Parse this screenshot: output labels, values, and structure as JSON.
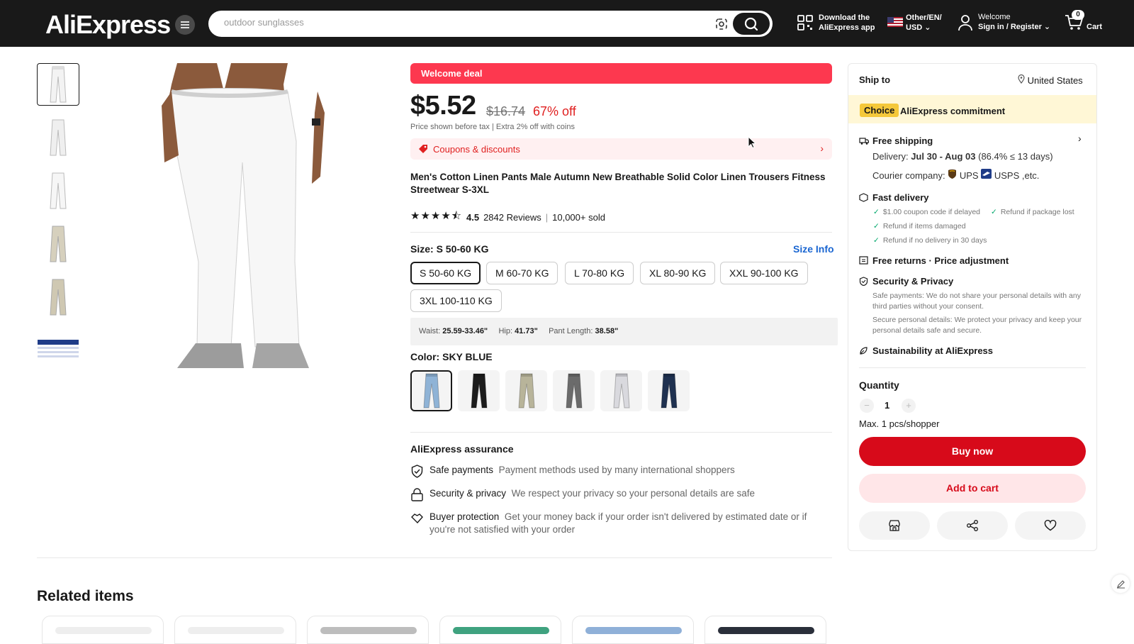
{
  "header": {
    "logo": "AliExpress",
    "search_placeholder": "outdoor sunglasses",
    "download_line1": "Download the",
    "download_line2": "AliExpress app",
    "locale_line1": "Other/EN/",
    "locale_line2": "USD",
    "welcome_line1": "Welcome",
    "welcome_line2": "Sign in / Register",
    "cart_count": "0",
    "cart_label": "Cart"
  },
  "product": {
    "welcome_deal": "Welcome deal",
    "price": "$5.52",
    "old_price": "$16.74",
    "discount": "67% off",
    "tax_note": "Price shown before tax",
    "coins_note": "Extra 2% off with coins",
    "coupons": "Coupons & discounts",
    "title": "Men's Cotton Linen Pants Male Autumn New Breathable Solid Color Linen Trousers Fitness Streetwear S-3XL",
    "rating": "4.5",
    "reviews": "2842 Reviews",
    "sold": "10,000+ sold",
    "size_label": "Size: S 50-60 KG",
    "size_info": "Size Info",
    "sizes": [
      "S 50-60 KG",
      "M 60-70 KG",
      "L 70-80 KG",
      "XL 80-90 KG",
      "XXL 90-100 KG",
      "3XL 100-110 KG"
    ],
    "measure": {
      "waist_k": "Waist:",
      "waist_v": "25.59-33.46\"",
      "hip_k": "Hip:",
      "hip_v": "41.73\"",
      "len_k": "Pant Length:",
      "len_v": "38.58\""
    },
    "color_label": "Color: SKY BLUE",
    "colors": [
      "#8fb3d6",
      "#1c1c1c",
      "#b8b49a",
      "#6b6b6b",
      "#d9d9de",
      "#1f3150"
    ]
  },
  "assurance": {
    "title": "AliExpress assurance",
    "items": [
      {
        "k": "Safe payments",
        "v": "Payment methods used by many international shoppers"
      },
      {
        "k": "Security & privacy",
        "v": "We respect your privacy so your personal details are safe"
      },
      {
        "k": "Buyer protection",
        "v": "Get your money back if your order isn't delivered by estimated date or if you're not satisfied with your order"
      }
    ]
  },
  "panel": {
    "ship_to": "Ship to",
    "country": "United States",
    "choice": "Choice",
    "commitment": "AliExpress commitment",
    "free_shipping": "Free shipping",
    "delivery_k": "Delivery:",
    "delivery_v": "Jul 30 - Aug 03",
    "delivery_note": "(86.4% ≤ 13 days)",
    "courier_k": "Courier company:",
    "courier_ups": "UPS",
    "courier_usps": "USPS ,etc.",
    "fast_delivery": "Fast delivery",
    "fd1": "$1.00 coupon code if delayed",
    "fd2": "Refund if package lost",
    "fd3": "Refund if items damaged",
    "fd4": "Refund if no delivery in 30 days",
    "free_returns": "Free returns · Price adjustment",
    "security": "Security & Privacy",
    "sec1": "Safe payments: We do not share your personal details with any third parties without your consent.",
    "sec2": "Secure personal details: We protect your privacy and keep your personal details safe and secure.",
    "sustain": "Sustainability at AliExpress",
    "quantity": "Quantity",
    "qty_value": "1",
    "max_note": "Max. 1 pcs/shopper",
    "buy_now": "Buy now",
    "add_to_cart": "Add to cart"
  },
  "related": {
    "title": "Related items"
  }
}
